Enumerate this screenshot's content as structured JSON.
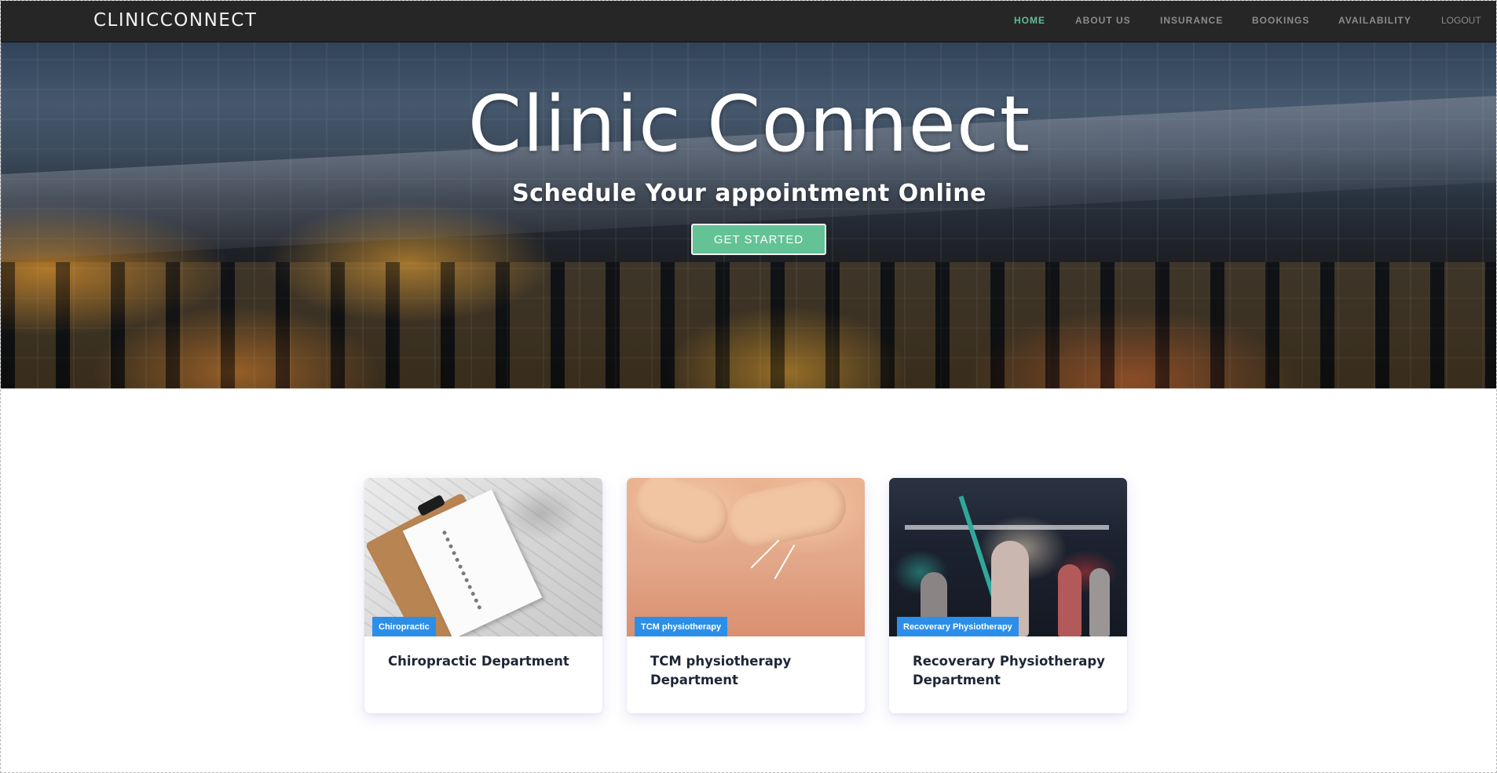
{
  "navbar": {
    "brand": "CLINICCONNECT",
    "items": [
      {
        "label": "HOME",
        "active": true
      },
      {
        "label": "ABOUT US"
      },
      {
        "label": "INSURANCE"
      },
      {
        "label": "BOOKINGS"
      },
      {
        "label": "AVAILABILITY"
      },
      {
        "label": "LOGOUT"
      }
    ]
  },
  "hero": {
    "title": "Clinic Connect",
    "subtitle": "Schedule Your appointment Online",
    "button_label": "GET STARTED"
  },
  "cards": [
    {
      "tag": "Chiropractic",
      "title": "Chiropractic Department"
    },
    {
      "tag": "TCM physiotherapy",
      "title": "TCM physiotherapy Department"
    },
    {
      "tag": "Recoverary Physiotherapy",
      "title": "Recoverary Physiotherapy Department"
    }
  ],
  "colors": {
    "navbar_bg": "#262626",
    "nav_active": "#5fbf94",
    "nav_inactive": "#8c8c8c",
    "button_bg": "#63c296",
    "tag_bg": "#2b8fe9",
    "card_title": "#1e2636"
  }
}
